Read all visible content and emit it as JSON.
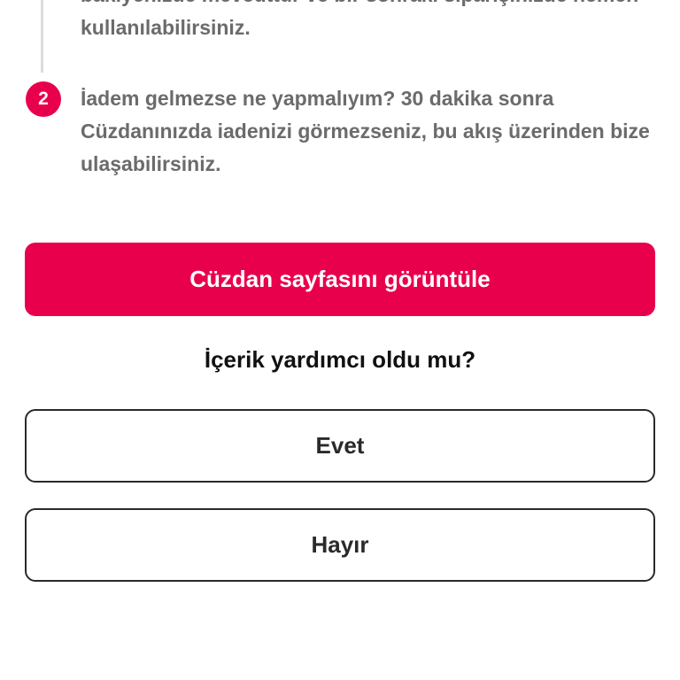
{
  "steps": [
    {
      "number": "",
      "text": "bakiyenizde mevcuttur ve bir sonraki siparişinizde hemen kullanılabilirsiniz."
    },
    {
      "number": "2",
      "text": "İadem gelmezse ne yapmalıyım? 30 dakika sonra Cüzdanınızda iadenizi görmezseniz, bu akış üzerinden bize ulaşabilirsiniz."
    }
  ],
  "primary_action": {
    "label": "Cüzdan sayfasını görüntüle"
  },
  "feedback": {
    "question": "İçerik yardımcı oldu mu?",
    "yes_label": "Evet",
    "no_label": "Hayır"
  },
  "colors": {
    "accent": "#e8004d",
    "step_text": "#6b6b6b",
    "outline": "#2a2a2a"
  }
}
